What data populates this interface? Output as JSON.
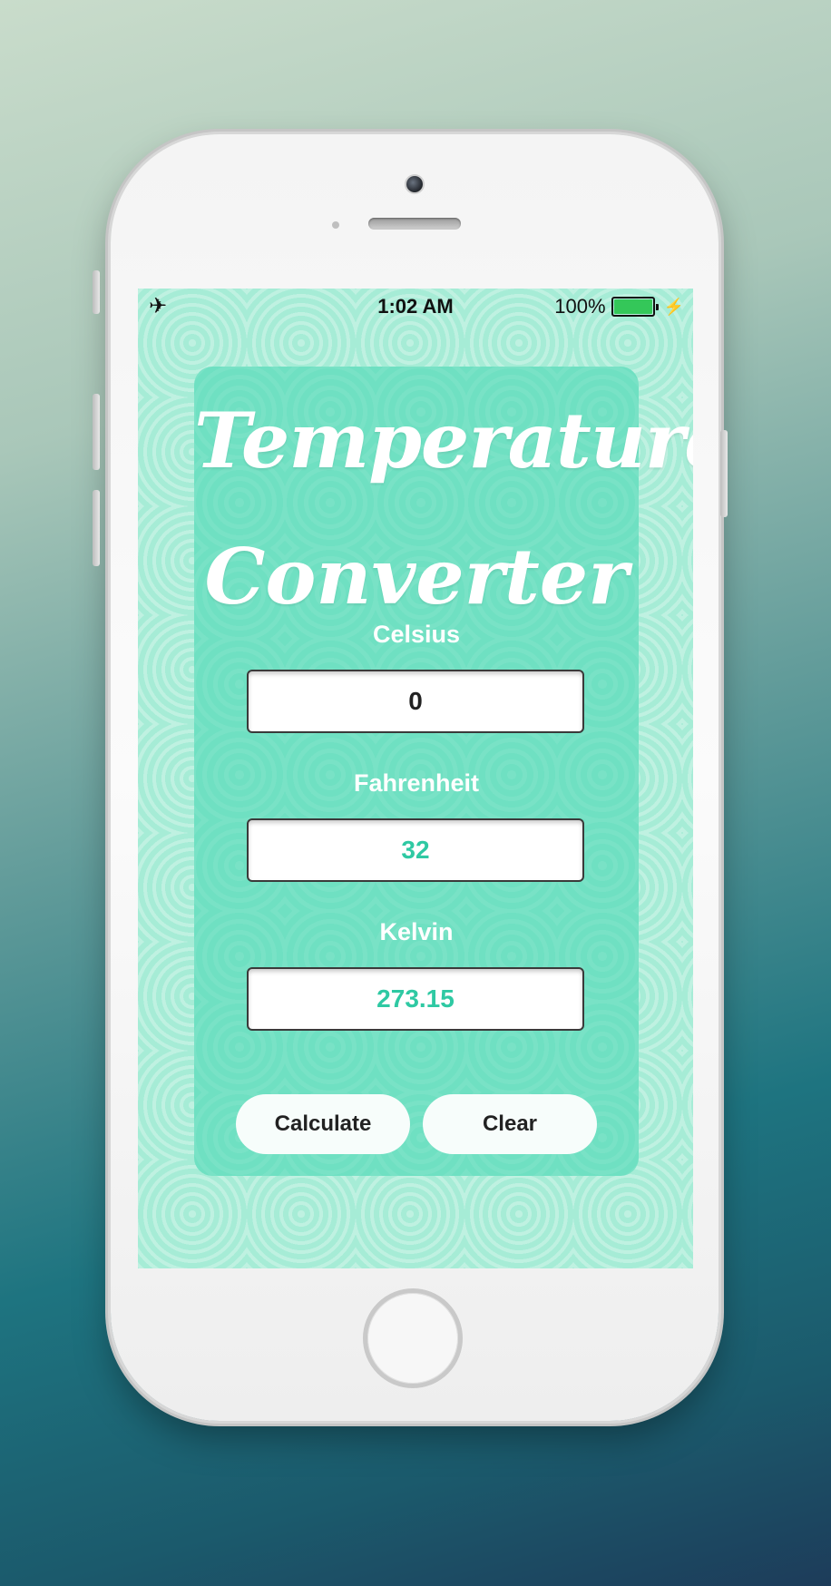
{
  "status_bar": {
    "time": "1:02 AM",
    "battery_percent": "100%",
    "battery_level": 1.0
  },
  "app": {
    "title_line1": "Temperature",
    "title_line2": "Converter",
    "celsius": {
      "label": "Celsius",
      "value": "0"
    },
    "fahrenheit": {
      "label": "Fahrenheit",
      "value": "32"
    },
    "kelvin": {
      "label": "Kelvin",
      "value": "273.15"
    },
    "calculate_label": "Calculate",
    "clear_label": "Clear"
  },
  "icons": [
    "airplane-icon",
    "battery-icon",
    "charging-bolt-icon"
  ],
  "colors": {
    "card": "#6fe0c2",
    "screen_background": "#a6ecd6",
    "output_text": "#2fc9a3",
    "battery_fill": "#34c759"
  }
}
